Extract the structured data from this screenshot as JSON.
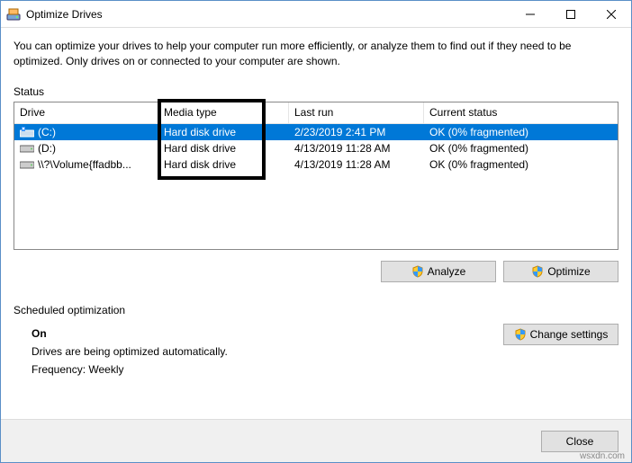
{
  "window": {
    "title": "Optimize Drives"
  },
  "description": "You can optimize your drives to help your computer run more efficiently, or analyze them to find out if they need to be optimized. Only drives on or connected to your computer are shown.",
  "status_label": "Status",
  "columns": {
    "drive": "Drive",
    "media": "Media type",
    "lastrun": "Last run",
    "status": "Current status"
  },
  "drives": [
    {
      "name": "(C:)",
      "media": "Hard disk drive",
      "lastrun": "2/23/2019 2:41 PM",
      "status": "OK (0% fragmented)",
      "selected": true,
      "icon": "os"
    },
    {
      "name": "(D:)",
      "media": "Hard disk drive",
      "lastrun": "4/13/2019 11:28 AM",
      "status": "OK (0% fragmented)",
      "selected": false,
      "icon": "hdd"
    },
    {
      "name": "\\\\?\\Volume{ffadbb...",
      "media": "Hard disk drive",
      "lastrun": "4/13/2019 11:28 AM",
      "status": "OK (0% fragmented)",
      "selected": false,
      "icon": "hdd"
    }
  ],
  "buttons": {
    "analyze": "Analyze",
    "optimize": "Optimize",
    "change": "Change settings",
    "close": "Close"
  },
  "scheduled": {
    "label": "Scheduled optimization",
    "state": "On",
    "desc": "Drives are being optimized automatically.",
    "freq": "Frequency: Weekly"
  },
  "watermark": "wsxdn.com"
}
